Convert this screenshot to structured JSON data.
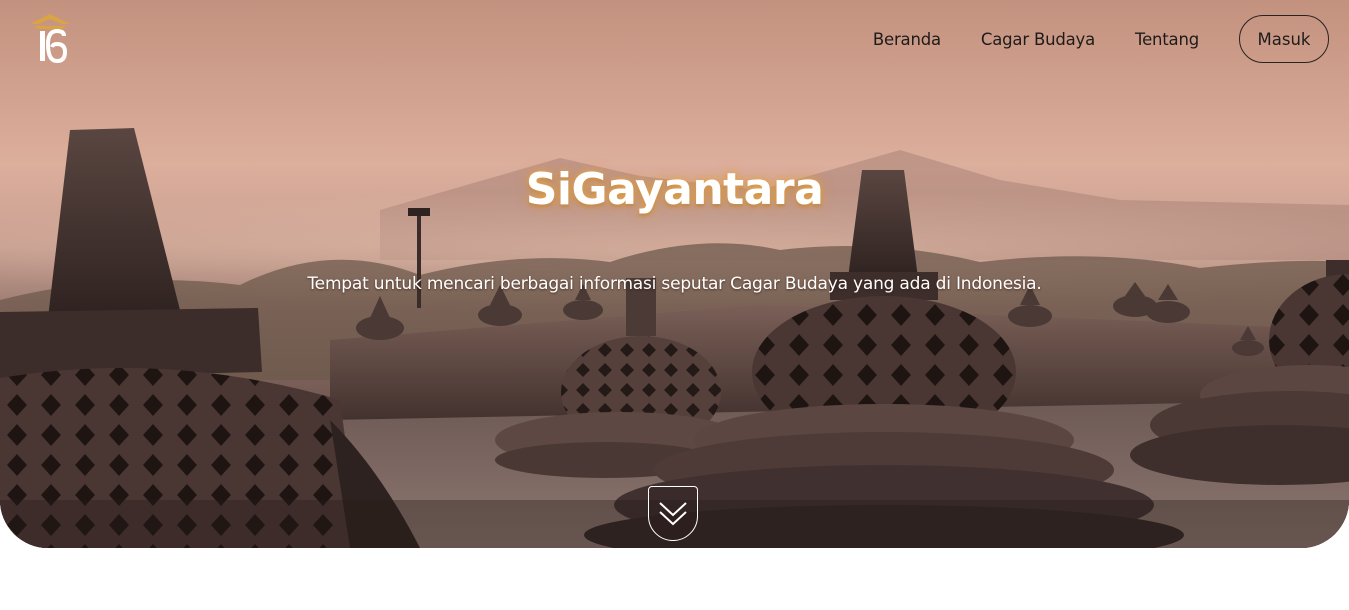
{
  "brand": {
    "logo_icon": "sigayantara-temple-logo",
    "accent_color": "#d9a441"
  },
  "nav": {
    "items": [
      {
        "label": "Beranda"
      },
      {
        "label": "Cagar Budaya"
      },
      {
        "label": "Tentang"
      }
    ],
    "login_label": "Masuk"
  },
  "hero": {
    "title": "SiGayantara",
    "subtitle": "Tempat untuk mencari berbagai informasi seputar Cagar Budaya yang ada di Indonesia.",
    "background": "borobudur-stupas-sunrise-photo",
    "scroll_icon": "chevron-double-down-icon"
  }
}
